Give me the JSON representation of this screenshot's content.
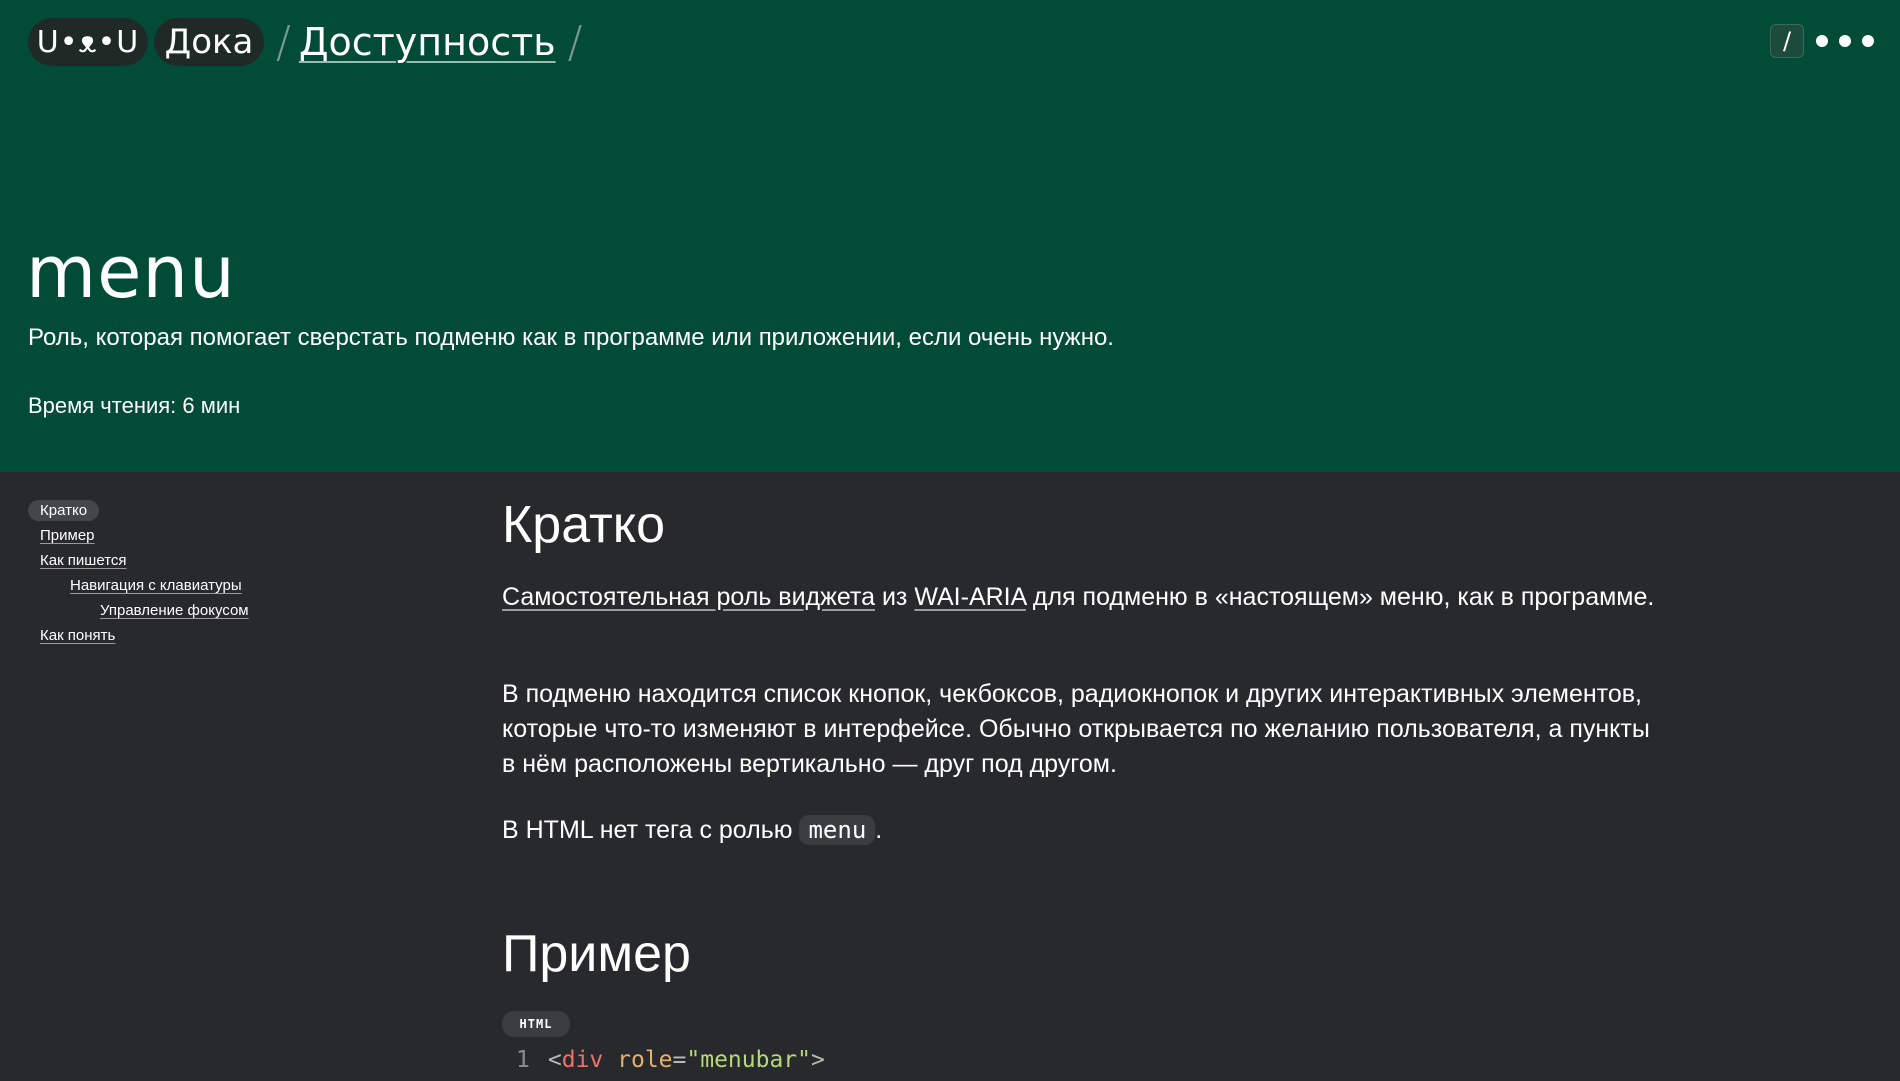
{
  "header": {
    "logo": "U•ᴥ•U",
    "brand": "Дока",
    "separator": "/",
    "section": "Доступность",
    "search_key": "/",
    "title": "menu",
    "subtitle": "Роль, которая помогает сверстать подменю как в программе или приложении, если очень нужно.",
    "read_time": "Время чтения: 6 мин"
  },
  "toc": {
    "items": [
      {
        "label": "Кратко"
      },
      {
        "label": "Пример"
      },
      {
        "label": "Как пишется"
      },
      {
        "label": "Навигация с клавиатуры"
      },
      {
        "label": "Управление фокусом"
      },
      {
        "label": "Как понять"
      }
    ]
  },
  "content": {
    "section1": {
      "heading": "Кратко",
      "p1_link1": "Самостоятельная роль виджета",
      "p1_mid": " из ",
      "p1_link2": "WAI-ARIA",
      "p1_rest": " для подменю в «настоящем» меню, как в программе.",
      "p2": "В подменю находится список кнопок, чекбоксов, радиокнопок и других интерактивных элементов, которые что-то изменяют в интерфейсе. Обычно открывается по желанию пользователя, а пункты в нём расположены вертикально — друг под другом.",
      "p3_pre": "В HTML нет тега с ролью ",
      "p3_code": "menu",
      "p3_post": "."
    },
    "section2": {
      "heading": "Пример",
      "code_lang": "HTML",
      "code": {
        "line_no": "1",
        "open": "<",
        "tag": "div",
        "space": " ",
        "attr": "role",
        "eq": "=",
        "value": "\"menubar\"",
        "close": ">"
      }
    }
  }
}
